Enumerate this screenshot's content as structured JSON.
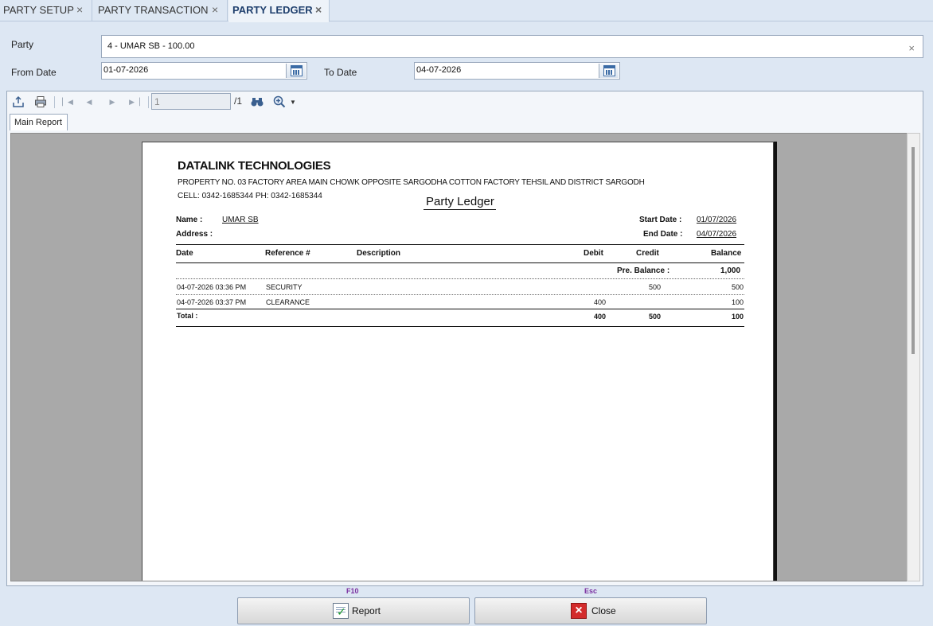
{
  "tabs": [
    {
      "label": "PARTY SETUP",
      "close": "×"
    },
    {
      "label": "PARTY TRANSACTION",
      "close": "×"
    },
    {
      "label": "PARTY LEDGER",
      "close": "×"
    }
  ],
  "filters": {
    "party_label": "Party",
    "party_value": "4 - UMAR SB - 100.00",
    "party_clear": "×",
    "from_label": "From Date",
    "from_value": "01-07-2026",
    "to_label": "To Date",
    "to_value": "04-07-2026"
  },
  "toolbar": {
    "page_value": "1",
    "page_total": "/1"
  },
  "report_tab": "Main Report",
  "report": {
    "company": "DATALINK TECHNOLOGIES",
    "address": "PROPERTY NO. 03 FACTORY AREA MAIN CHOWK OPPOSITE SARGODHA COTTON FACTORY TEHSIL AND DISTRICT SARGODH",
    "contact": "CELL: 0342-1685344 PH: 0342-1685344",
    "title": "Party Ledger",
    "name_label": "Name :",
    "name_value": "UMAR SB",
    "address_label": "Address :",
    "start_label": "Start Date :",
    "start_value": "01/07/2026",
    "end_label": "End Date :",
    "end_value": "04/07/2026",
    "columns": {
      "date": "Date",
      "reference": "Reference #",
      "description": "Description",
      "debit": "Debit",
      "credit": "Credit",
      "balance": "Balance"
    },
    "pre_balance_label": "Pre. Balance :",
    "pre_balance_value": "1,000",
    "rows": [
      {
        "date": "04-07-2026  03:36 PM",
        "reference": "SECURITY",
        "debit": "",
        "credit": "500",
        "balance": "500"
      },
      {
        "date": "04-07-2026  03:37 PM",
        "reference": "CLEARANCE",
        "debit": "400",
        "credit": "",
        "balance": "100"
      }
    ],
    "total_label": "Total :",
    "total_debit": "400",
    "total_credit": "500",
    "total_balance": "100"
  },
  "buttons": {
    "report_key": "F10",
    "report_label": "Report",
    "close_key": "Esc",
    "close_label": "Close"
  },
  "icons": {
    "export": "export-icon",
    "print": "print-icon",
    "first": "first-page-icon",
    "prev": "previous-page-icon",
    "next": "next-page-icon",
    "last": "last-page-icon",
    "find": "binoculars-icon",
    "zoom": "zoom-icon",
    "calendar": "calendar-icon"
  }
}
